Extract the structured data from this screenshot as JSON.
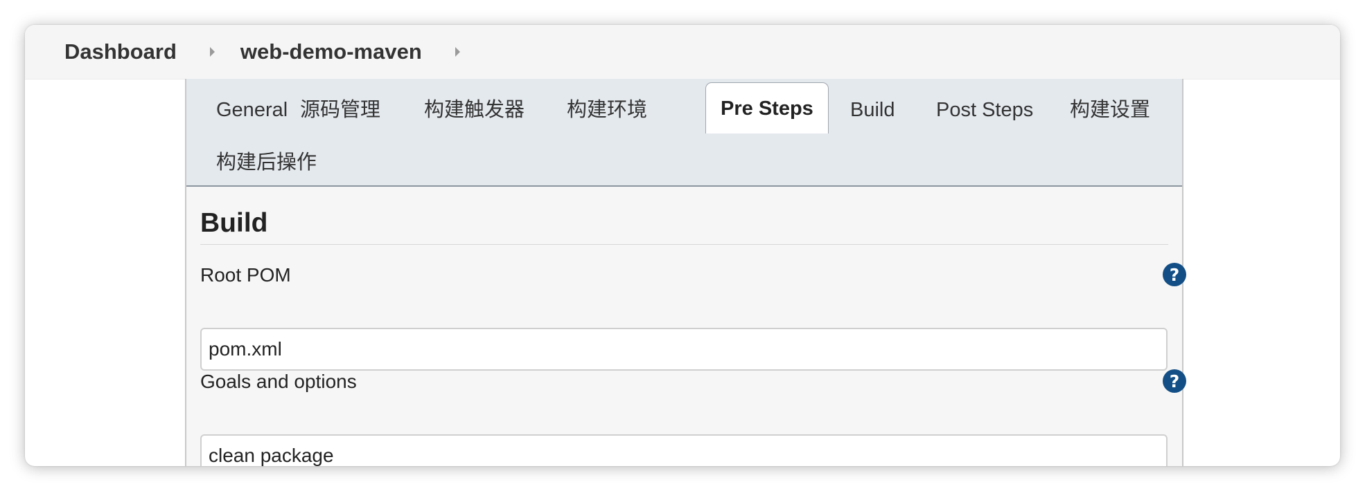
{
  "breadcrumb": {
    "items": [
      "Dashboard",
      "web-demo-maven"
    ]
  },
  "tabs": [
    {
      "label": "General",
      "active": false
    },
    {
      "label": "源码管理",
      "active": false
    },
    {
      "label": "构建触发器",
      "active": false
    },
    {
      "label": "构建环境",
      "active": false
    },
    {
      "label": "Pre Steps",
      "active": true
    },
    {
      "label": "Build",
      "active": false
    },
    {
      "label": "Post Steps",
      "active": false
    },
    {
      "label": "构建设置",
      "active": false
    },
    {
      "label": "构建后操作",
      "active": false
    }
  ],
  "section": {
    "title": "Build"
  },
  "fields": {
    "root_pom": {
      "label": "Root POM",
      "value": "pom.xml",
      "help": "?"
    },
    "goals": {
      "label": "Goals and options",
      "value": "clean package",
      "help": "?"
    }
  },
  "colors": {
    "help_icon": "#134f86",
    "tabbar_bg": "#e4e9ee",
    "topbar_bg": "#f5f5f5"
  }
}
